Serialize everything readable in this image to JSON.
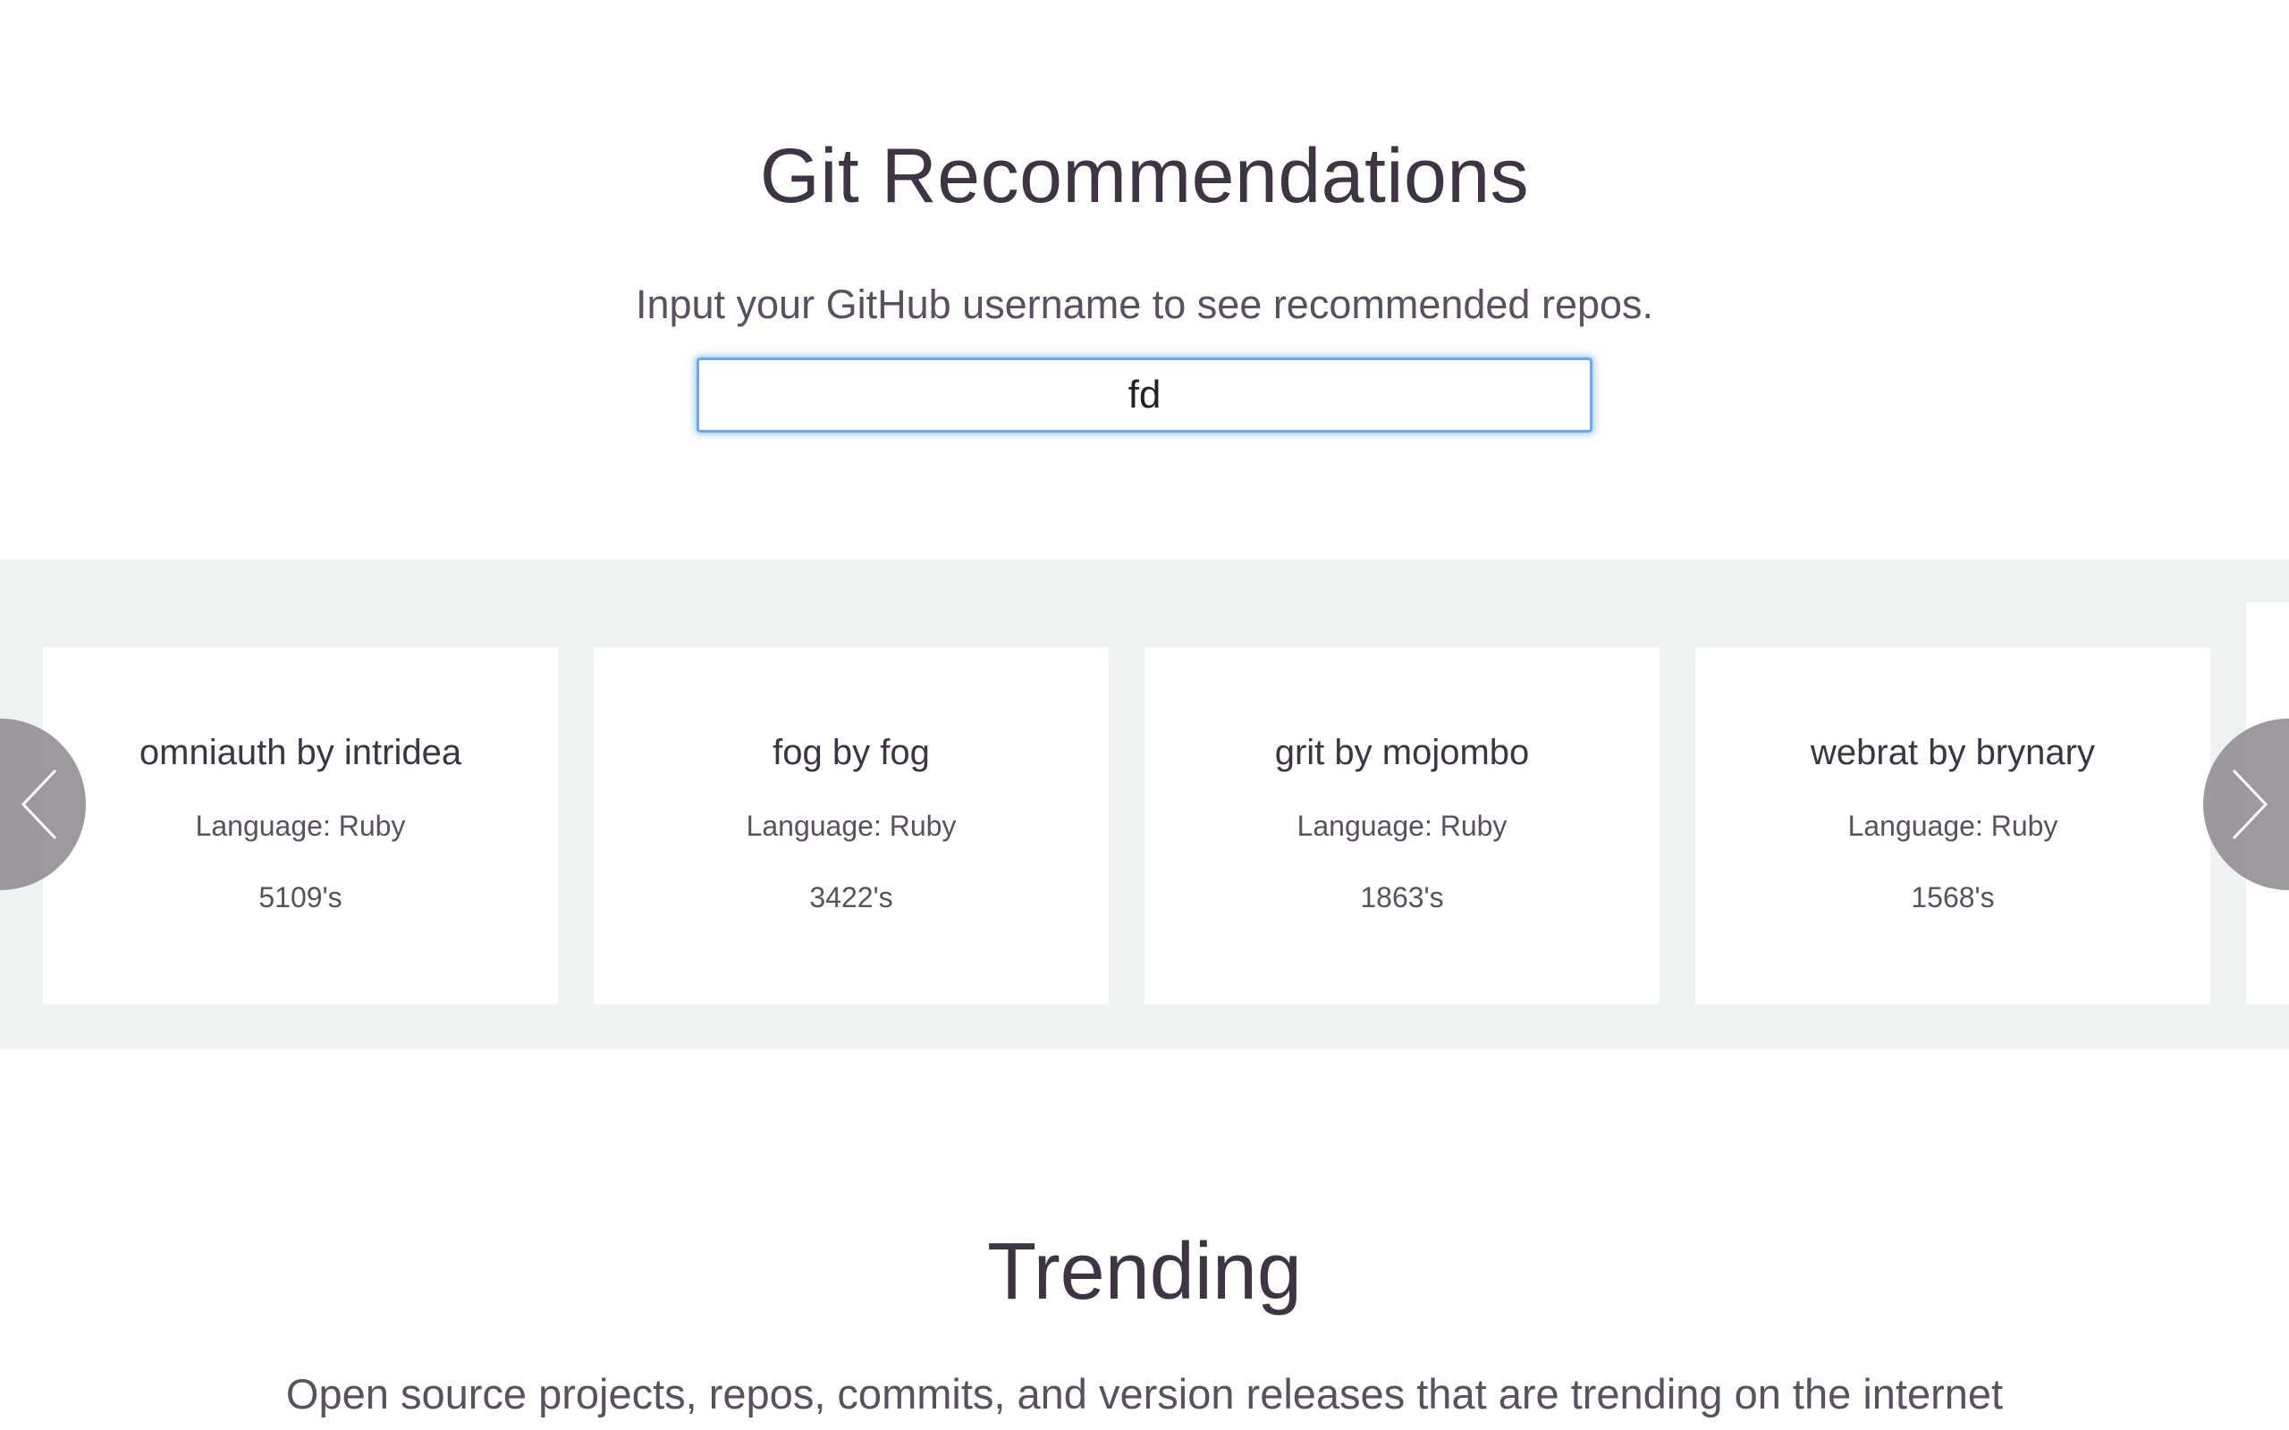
{
  "hero": {
    "title": "Git Recommendations",
    "subtitle": "Input your GitHub username to see recommended repos.",
    "search": {
      "value": "fd",
      "placeholder": ""
    }
  },
  "carousel": {
    "cards": [
      {
        "title": "omniauth by intridea",
        "language": "Language: Ruby",
        "stars": "5109's"
      },
      {
        "title": "fog by fog",
        "language": "Language: Ruby",
        "stars": "3422's"
      },
      {
        "title": "grit by mojombo",
        "language": "Language: Ruby",
        "stars": "1863's"
      },
      {
        "title": "webrat by brynary",
        "language": "Language: Ruby",
        "stars": "1568's"
      }
    ],
    "prev_icon": "chevron-left-icon",
    "next_icon": "chevron-right-icon"
  },
  "trending": {
    "title": "Trending",
    "subtitle": "Open source projects, repos, commits, and version releases that are trending on the internet"
  },
  "colors": {
    "text": "#3f3446",
    "muted": "#5a5060",
    "carousel_bg": "#f0f3f3",
    "focus_ring": "#6ea8e6",
    "nav_button": "#968f99"
  }
}
